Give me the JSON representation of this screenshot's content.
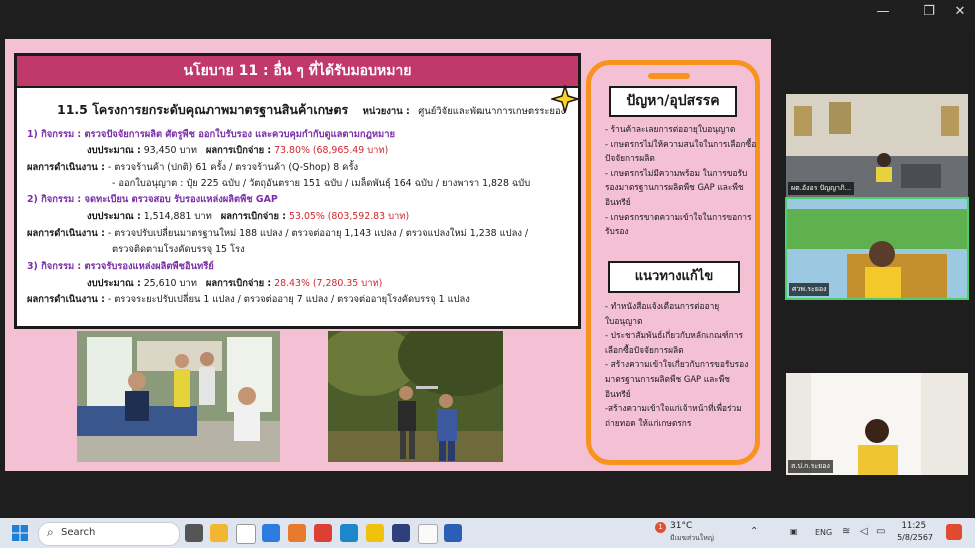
{
  "slide": {
    "title": "นโยบาย 11 : อื่น ๆ ที่ได้รับมอบหมาย",
    "project_title": "11.5 โครงการยกระดับคุณภาพมาตรฐานสินค้าเกษตร",
    "unit_label": "หน่วยงาน :",
    "unit_value": "ศูนย์วิจัยและพัฒนาการเกษตรระยอง",
    "budget_label": "งบประมาณ :",
    "spent_label": "ผลการเบิกจ่าย :",
    "result_label": "ผลการดำเนินงาน :",
    "activities": [
      {
        "title": "1) กิจกรรม : ตรวจปัจจัยการผลิต ศัตรูพืช ออกใบรับรอง และควบคุมกำกับดูแลตามกฎหมาย",
        "budget": "93,450 บาท",
        "spent": "73.80%  (68,965.49 บาท)",
        "results": [
          "- ตรวจร้านค้า (ปกติ) 61 ครั้ง / ตรวจร้านค้า (Q-Shop) 8 ครั้ง",
          "- ออกใบอนุญาต :  ปุ๋ย 225 ฉบับ / วัตถุอันตราย 151 ฉบับ / เมล็ดพันธุ์ 164 ฉบับ / ยางพารา 1,828 ฉบับ"
        ]
      },
      {
        "title": "2) กิจกรรม : จดทะเบียน ตรวจสอบ รับรองแหล่งผลิตพืช GAP",
        "budget": "1,514,881 บาท",
        "spent": "53.05%  (803,592.83 บาท)",
        "results": [
          "- ตรวจปรับเปลี่ยนมาตรฐานใหม่ 188 แปลง / ตรวจต่ออายุ 1,143 แปลง / ตรวจแปลงใหม่ 1,238 แปลง /",
          "ตรวจติดตามโรงคัดบรรจุ 15 โรง"
        ]
      },
      {
        "title": "3) กิจกรรม : ตรวจรับรองแหล่งผลิตพืชอินทรีย์",
        "budget": "25,610 บาท",
        "spent": "28.43%  (7,280.35 บาท)",
        "results": [
          "- ตรวจระยะปรับเปลี่ยน 1 แปลง / ตรวจต่ออายุ 7 แปลง / ตรวจต่ออายุโรงคัดบรรจุ 1 แปลง"
        ]
      }
    ],
    "problems": {
      "heading": "ปัญหา/อุปสรรค",
      "lines": [
        "- ร้านค้าละเลยการต่ออายุใบอนุญาต",
        "- เกษตรกรไม่ให้ความสนใจในการเลือกซื้อ",
        "ปัจจัยการผลิต",
        "- เกษตรกรไม่มีความพร้อม ในการขอรับ",
        "รองมาตรฐานการผลิตพืช GAP และพืช",
        "อินทรีย์",
        "- เกษตรกรขาดความเข้าใจในการขอการ",
        "รับรอง"
      ]
    },
    "solutions": {
      "heading": "แนวทางแก้ไข",
      "lines": [
        "- ทำหนังสือแจ้งเตือนการต่ออายุ",
        "ใบอนุญาต",
        "- ประชาสัมพันธ์เกี่ยวกับหลักเกณฑ์การ",
        "เลือกซื้อปัจจัยการผลิต",
        "- สร้างความเข้าใจเกี่ยวกับการขอรับรอง",
        "มาตรฐานการผลิตพืช GAP และพืช",
        "อินทรีย์",
        "-สร้างความเข้าใจแก่เจ้าหน้าที่เพื่อร่วม",
        "ถ่ายทอด ให้แก่เกษตรกร"
      ]
    }
  },
  "participants": [
    {
      "label": "ผต.อังอร  ปัญญาภิ..."
    },
    {
      "label": "ศวพ.ระยอง"
    },
    {
      "label": "ส.ป.ก.ระยอง"
    }
  ],
  "taskbar": {
    "search_placeholder": "Search",
    "weather_temp": "31°C",
    "weather_desc": "มีเมฆส่วนใหญ่",
    "weather_badge": "1",
    "lang": "ENG",
    "time": "11:25",
    "date": "5/8/2567"
  },
  "colors": {
    "title_bar": "#c0396a",
    "slide_bg": "#f3c0d4",
    "phone_border": "#f7931e",
    "activity": "#7a2fa8",
    "spent": "#d0262c"
  }
}
